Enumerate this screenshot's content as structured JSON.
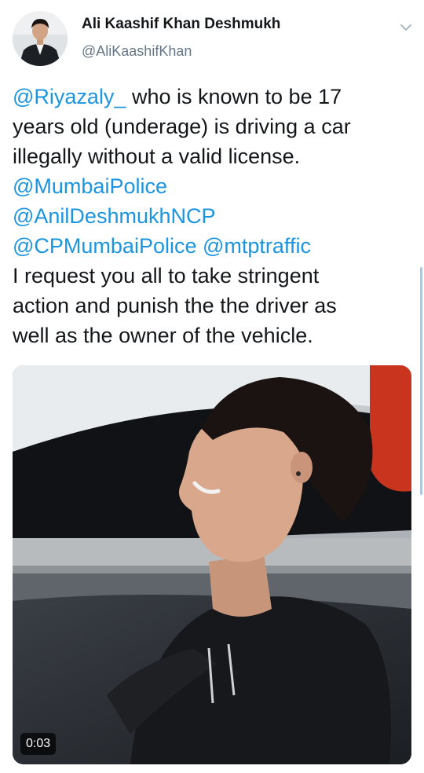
{
  "author": {
    "display_name": "Ali Kaashif Khan Deshmukh",
    "handle": "@AliKaashifKhan",
    "avatar_icon": "profile-photo"
  },
  "menu": {
    "icon": "chevron-down-icon"
  },
  "tweet": {
    "lines": [
      {
        "parts": [
          {
            "text": "@Riyazaly_",
            "mention": true
          },
          {
            "text": " who is known to be 17",
            "mention": false
          }
        ]
      },
      {
        "parts": [
          {
            "text": "years old (underage) is driving a car",
            "mention": false
          }
        ]
      },
      {
        "parts": [
          {
            "text": "illegally without a valid license.",
            "mention": false
          }
        ]
      },
      {
        "parts": [
          {
            "text": "@MumbaiPolice",
            "mention": true
          }
        ]
      },
      {
        "parts": [
          {
            "text": "@AnilDeshmukhNCP",
            "mention": true
          }
        ]
      },
      {
        "parts": [
          {
            "text": "@CPMumbaiPolice",
            "mention": true
          },
          {
            "text": " ",
            "mention": false
          },
          {
            "text": "@mtptraffic",
            "mention": true
          }
        ]
      },
      {
        "parts": [
          {
            "text": "I request you all to take stringent",
            "mention": false
          }
        ]
      },
      {
        "parts": [
          {
            "text": "action and punish the the driver as",
            "mention": false
          }
        ]
      },
      {
        "parts": [
          {
            "text": "well as the owner of the vehicle.",
            "mention": false
          }
        ]
      }
    ]
  },
  "media": {
    "type": "video",
    "duration": "0:03"
  },
  "colors": {
    "text": "#14171a",
    "secondary": "#657786",
    "link": "#1b95e0",
    "scroll_indicator": "#9ccbf0"
  }
}
